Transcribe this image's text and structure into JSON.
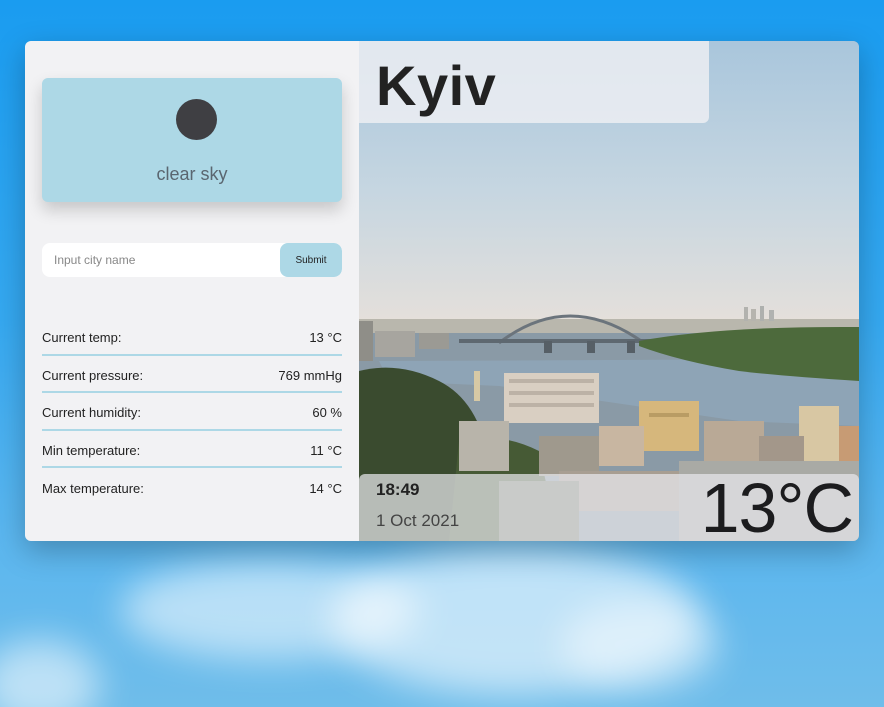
{
  "weather": {
    "condition": "clear sky",
    "city": "Kyiv",
    "time": "18:49",
    "date": "1 Oct 2021",
    "temperature_display": "13°C"
  },
  "search": {
    "placeholder": "Input city name",
    "value": "",
    "submit_label": "Submit"
  },
  "stats": [
    {
      "label": "Current temp:",
      "value": "13 °C"
    },
    {
      "label": "Current pressure:",
      "value": "769 mmHg"
    },
    {
      "label": "Current humidity:",
      "value": "60 %"
    },
    {
      "label": "Min temperature:",
      "value": "11 °C"
    },
    {
      "label": "Max temperature:",
      "value": "14 °C"
    }
  ],
  "icons": {
    "condition_icon": "sun-icon"
  },
  "colors": {
    "accent": "#add8e6",
    "panel": "#f2f2f4",
    "sky_top": "#1a9cf0"
  }
}
